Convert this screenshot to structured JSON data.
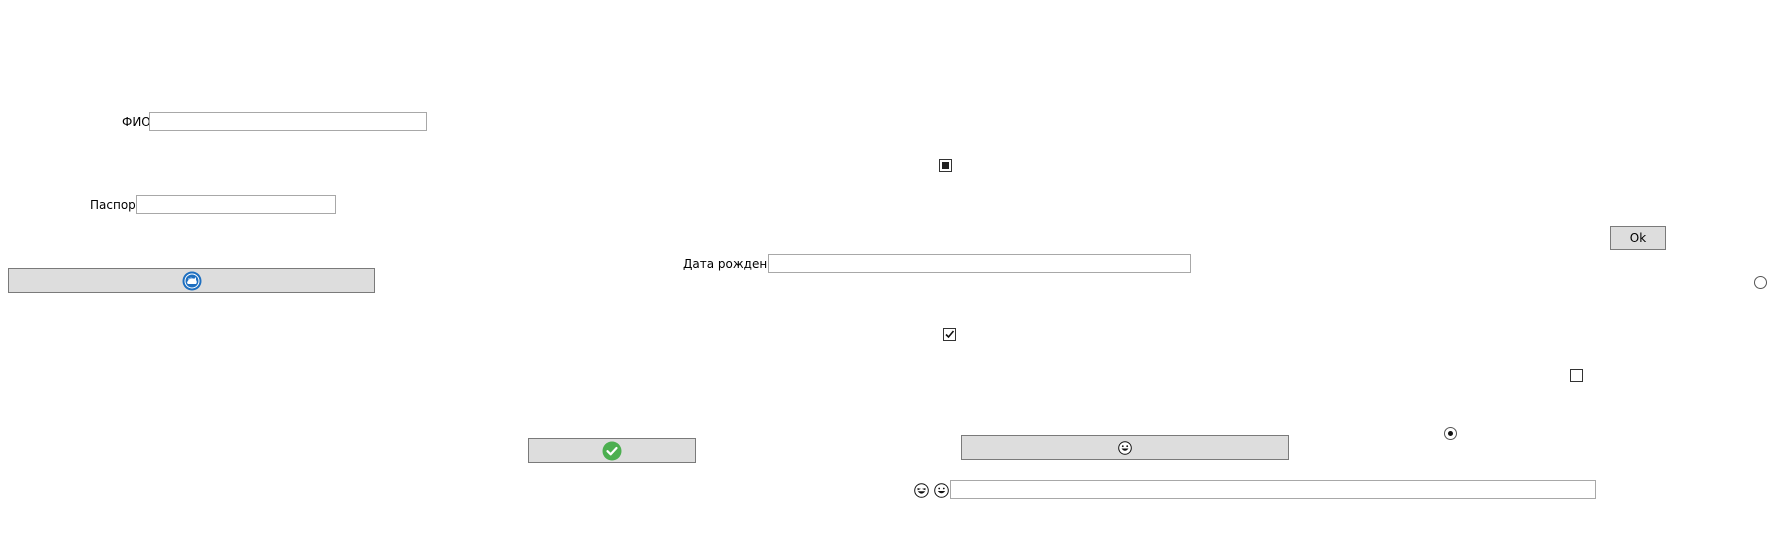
{
  "labels": {
    "fio": "ФИО",
    "passport": "Паспорт",
    "birthdate": "Дата рождения"
  },
  "inputs": {
    "fio_value": "",
    "passport_value": "",
    "birthdate_value": "",
    "bottom_value": ""
  },
  "buttons": {
    "ok_label": "Ok"
  },
  "icons": {
    "left_button_icon": "dolphin-badge-icon",
    "middle_button_icon": "green-checkmark-icon",
    "right_button_icon": "grinning-face-icon",
    "bottom_left_icons": [
      "laughing-face-icon",
      "grinning-face-icon"
    ]
  },
  "controls": {
    "top_checkbox_state": "indeterminate",
    "middle_checkbox_checked": true,
    "right_checkbox_checked": false,
    "radio_top_right_selected": false,
    "radio_lower_selected": true
  },
  "colors": {
    "window_bg": "#ffffff",
    "button_bg": "#dddddd",
    "input_border": "#a8a8a8",
    "check_green": "#4caf50",
    "badge_blue": "#1e6fc0"
  }
}
